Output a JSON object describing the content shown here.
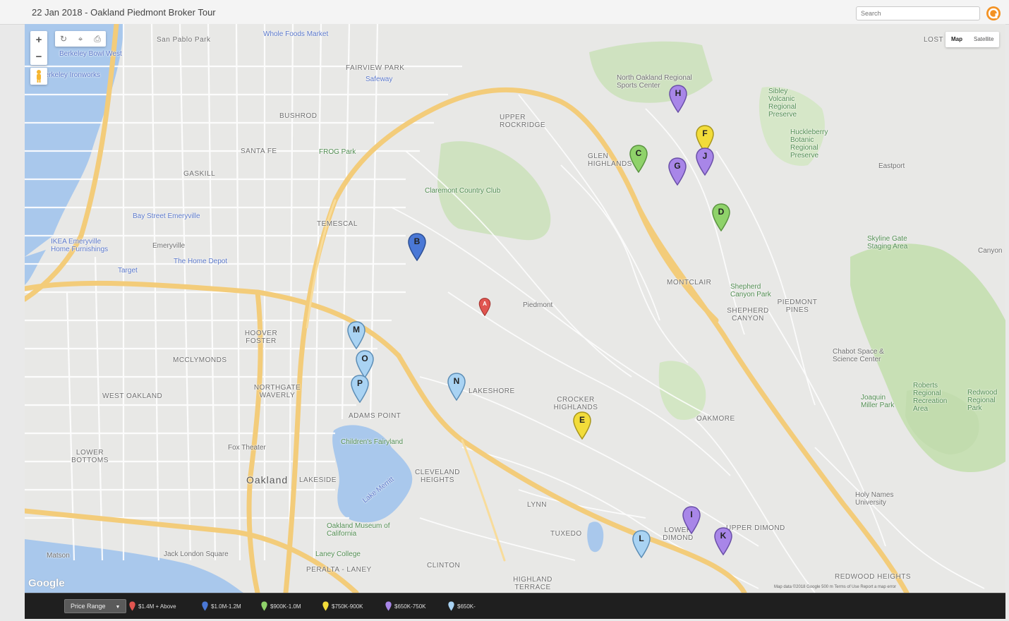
{
  "header": {
    "title": "22 Jan 2018 - Oakland Piedmont Broker Tour",
    "search_placeholder": "Search"
  },
  "map_controls": {
    "zoom_in": "+",
    "zoom_out": "−",
    "map_type_map": "Map",
    "map_type_satellite": "Satellite",
    "attribution": "Map data ©2018 Google   500 m   Terms of Use   Report a map error",
    "google_logo": "Google"
  },
  "places": [
    {
      "text": "San Pablo Park"
    },
    {
      "text": "Whole Foods Market"
    },
    {
      "text": "Berkeley Bowl West"
    },
    {
      "text": "Berkeley Ironworks"
    },
    {
      "text": "FAIRVIEW PARK"
    },
    {
      "text": "Safeway"
    },
    {
      "text": "BUSHROD"
    },
    {
      "text": "SANTA FE"
    },
    {
      "text": "GASKILL"
    },
    {
      "text": "FROG Park"
    },
    {
      "text": "UPPER ROCKRIDGE"
    },
    {
      "text": "North Oakland Regional Sports Center"
    },
    {
      "text": "Sibley Volcanic Regional Preserve"
    },
    {
      "text": "Huckleberry Botanic Regional Preserve"
    },
    {
      "text": "GLEN HIGHLANDS"
    },
    {
      "text": "Eastport"
    },
    {
      "text": "Claremont Country Club"
    },
    {
      "text": "Bay Street Emeryville"
    },
    {
      "text": "TEMESCAL"
    },
    {
      "text": "IKEA Emeryville Home Furnishings"
    },
    {
      "text": "Emeryville"
    },
    {
      "text": "The Home Depot"
    },
    {
      "text": "Target"
    },
    {
      "text": "Skyline Gate Staging Area"
    },
    {
      "text": "MONTCLAIR"
    },
    {
      "text": "Shepherd Canyon Park"
    },
    {
      "text": "SHEPHERD CANYON"
    },
    {
      "text": "PIEDMONT PINES"
    },
    {
      "text": "Piedmont"
    },
    {
      "text": "HOOVER FOSTER"
    },
    {
      "text": "MCCLYMONDS"
    },
    {
      "text": "NORTHGATE WAVERLY"
    },
    {
      "text": "WEST OAKLAND"
    },
    {
      "text": "ADAMS POINT"
    },
    {
      "text": "LAKESHORE"
    },
    {
      "text": "CROCKER HIGHLANDS"
    },
    {
      "text": "Chabot Space & Science Center"
    },
    {
      "text": "Joaquin Miller Park"
    },
    {
      "text": "Roberts Regional Recreation Area"
    },
    {
      "text": "Redwood Regional Park"
    },
    {
      "text": "OAKMORE"
    },
    {
      "text": "Children's Fairyland"
    },
    {
      "text": "Fox Theater"
    },
    {
      "text": "LOWER BOTTOMS"
    },
    {
      "text": "Oakland"
    },
    {
      "text": "LAKESIDE"
    },
    {
      "text": "CLEVELAND HEIGHTS"
    },
    {
      "text": "Lake Merritt"
    },
    {
      "text": "LYNN"
    },
    {
      "text": "TUXEDO"
    },
    {
      "text": "Oakland Museum of California"
    },
    {
      "text": "Laney College"
    },
    {
      "text": "Matson"
    },
    {
      "text": "Jack London Square"
    },
    {
      "text": "PERALTA - LANEY"
    },
    {
      "text": "CLINTON"
    },
    {
      "text": "HIGHLAND TERRACE"
    },
    {
      "text": "LOWER DIMOND"
    },
    {
      "text": "UPPER DIMOND"
    },
    {
      "text": "Holy Names University"
    },
    {
      "text": "REDWOOD HEIGHTS"
    },
    {
      "text": "LOST"
    },
    {
      "text": "Canyon"
    }
  ],
  "pins": [
    {
      "label": "A",
      "price_range": "$1.4M + Above",
      "color": "#e05550"
    },
    {
      "label": "B",
      "price_range": "$1.0M-1.2M",
      "color": "#4a78d6"
    },
    {
      "label": "C",
      "price_range": "$900K-1.0M",
      "color": "#8fd26a"
    },
    {
      "label": "D",
      "price_range": "$900K-1.0M",
      "color": "#8fd26a"
    },
    {
      "label": "E",
      "price_range": "$750K-900K",
      "color": "#f2dc3a"
    },
    {
      "label": "F",
      "price_range": "$750K-900K",
      "color": "#f2dc3a"
    },
    {
      "label": "G",
      "price_range": "$650K-750K",
      "color": "#a886e8"
    },
    {
      "label": "H",
      "price_range": "$650K-750K",
      "color": "#a886e8"
    },
    {
      "label": "I",
      "price_range": "$650K-750K",
      "color": "#a886e8"
    },
    {
      "label": "J",
      "price_range": "$650K-750K",
      "color": "#a886e8"
    },
    {
      "label": "K",
      "price_range": "$650K-750K",
      "color": "#a886e8"
    },
    {
      "label": "L",
      "price_range": "$650K-",
      "color": "#a9d3f3"
    },
    {
      "label": "M",
      "price_range": "$650K-",
      "color": "#a9d3f3"
    },
    {
      "label": "N",
      "price_range": "$650K-",
      "color": "#a9d3f3"
    },
    {
      "label": "O",
      "price_range": "$650K-",
      "color": "#a9d3f3"
    },
    {
      "label": "P",
      "price_range": "$650K-",
      "color": "#a9d3f3"
    }
  ],
  "legend": {
    "button_label": "Price Range",
    "items": [
      {
        "label": "$1.4M + Above",
        "color": "#e05550"
      },
      {
        "label": "$1.0M-1.2M",
        "color": "#4a78d6"
      },
      {
        "label": "$900K-1.0M",
        "color": "#8fd26a"
      },
      {
        "label": "$750K-900K",
        "color": "#f2dc3a"
      },
      {
        "label": "$650K-750K",
        "color": "#a886e8"
      },
      {
        "label": "$650K-",
        "color": "#a9d3f3"
      }
    ]
  }
}
